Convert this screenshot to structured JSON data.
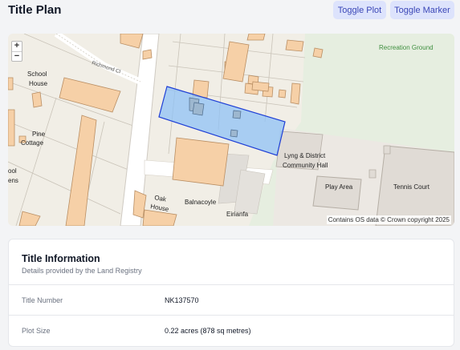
{
  "header": {
    "title": "Title Plan",
    "toggle_plot_label": "Toggle Plot",
    "toggle_marker_label": "Toggle Marker"
  },
  "map": {
    "zoom_in": "+",
    "zoom_out": "−",
    "labels": {
      "recreation_ground": "Recreation Ground",
      "richmond_cl": "Richmond Cl",
      "school": "School",
      "house": "House",
      "pine": "Pine",
      "cottage": "Cottage",
      "ool": "ool",
      "ens": "ens",
      "lyng_district": "Lyng & District",
      "community_hall": "Community Hall",
      "play_area": "Play Area",
      "tennis_court": "Tennis Court",
      "balnacoyle": "Balnacoyle",
      "oak": "Oak",
      "oak_house": "House",
      "eirianfa": "Eirianfa"
    },
    "attribution": "Contains OS data © Crown copyright 2025",
    "colors": {
      "plot_fill": "#8fc2f5",
      "plot_stroke": "#1f3fd6",
      "recreation": "#e7efe2",
      "building": "#f6d0a7"
    }
  },
  "title_info": {
    "heading": "Title Information",
    "subheading": "Details provided by the Land Registry",
    "rows": [
      {
        "label": "Title Number",
        "value": "NK137570"
      },
      {
        "label": "Plot Size",
        "value": "0.22 acres (878 sq metres)"
      }
    ]
  }
}
